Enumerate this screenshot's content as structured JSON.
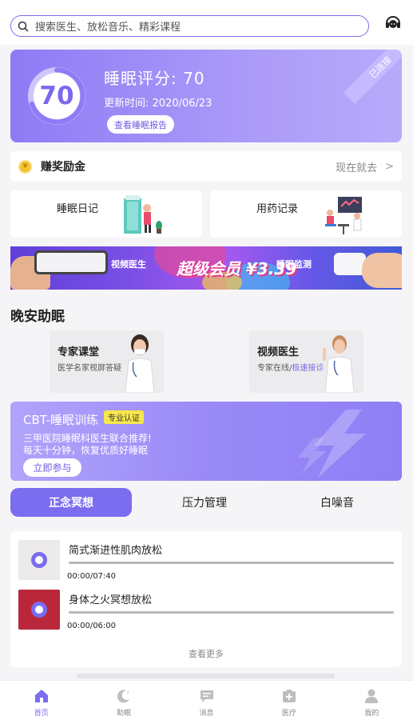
{
  "search": {
    "placeholder": "搜索医生、放松音乐、精彩课程",
    "icon": "search-icon"
  },
  "header": {
    "service_icon": "customer-service-icon"
  },
  "sleep_score": {
    "score": "70",
    "score_fraction": 0.7,
    "title": "睡眠评分: 70",
    "updated": "更新时间: 2020/06/23",
    "report_button": "查看睡眠报告",
    "connection_status": "已连接",
    "accent": "#7b6cf0"
  },
  "reward": {
    "label": "赚奖励金",
    "action": "现在就去",
    "chevron": ">"
  },
  "shortcuts": [
    {
      "label": "睡眠日记"
    },
    {
      "label": "用药记录"
    }
  ],
  "banner": {
    "left_caption": "视频医生",
    "headline": "超级会员 ¥3.39",
    "right_caption": "睡眠监测"
  },
  "good_night": {
    "section_title": "晚安助眠",
    "cards": [
      {
        "title": "专家课堂",
        "subtitle": "医学名家视屏答疑",
        "subtitle_highlight": ""
      },
      {
        "title": "视频医生",
        "subtitle": "专家在线/",
        "subtitle_highlight": "极速接诊"
      }
    ]
  },
  "cbt": {
    "title": "CBT-睡眠训练",
    "badge": "专业认证",
    "line1": "三甲医院睡眠科医生联合推荐!",
    "line2": "每天十分钟，恢复优质好睡眠",
    "button": "立即参与"
  },
  "tabs": [
    {
      "label": "正念冥想",
      "active": true
    },
    {
      "label": "压力管理",
      "active": false
    },
    {
      "label": "白噪音",
      "active": false
    }
  ],
  "tracks": [
    {
      "title": "简式渐进性肌肉放松",
      "time": "00:00/07:40",
      "progress": 0
    },
    {
      "title": "身体之火冥想放松",
      "time": "00:00/06:00",
      "progress": 0
    }
  ],
  "list_more": "查看更多",
  "tabbar": [
    {
      "label": "首页",
      "icon": "home-icon",
      "active": true
    },
    {
      "label": "助眠",
      "icon": "moon-icon",
      "active": false
    },
    {
      "label": "消息",
      "icon": "message-icon",
      "active": false
    },
    {
      "label": "医疗",
      "icon": "medical-icon",
      "active": false
    },
    {
      "label": "我的",
      "icon": "profile-icon",
      "active": false
    }
  ]
}
